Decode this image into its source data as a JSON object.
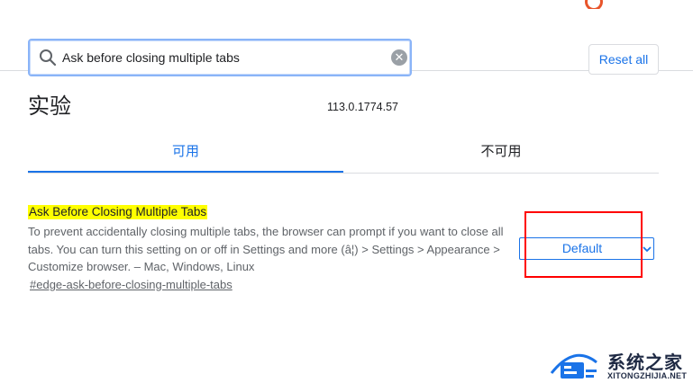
{
  "search": {
    "value": "Ask before closing multiple tabs",
    "clear_glyph": "✕",
    "icon": "search-icon"
  },
  "toolbar": {
    "reset_label": "Reset all"
  },
  "page": {
    "title": "实验",
    "version": "113.0.1774.57"
  },
  "tabs": [
    {
      "label": "可用",
      "active": true
    },
    {
      "label": "不可用",
      "active": false
    }
  ],
  "experiment": {
    "title": "Ask Before Closing Multiple Tabs",
    "description": "To prevent accidentally closing multiple tabs, the browser can prompt if you want to close all tabs. You can turn this setting on or off in Settings and more (â¦) > Settings > Appearance > Customize browser. – Mac, Windows, Linux",
    "link": "#edge-ask-before-closing-multiple-tabs",
    "select_value": "Default"
  },
  "watermark": {
    "title": "系统之家",
    "subtitle": "XITONGZHIJIA.NET"
  },
  "colors": {
    "accent": "#1a73e8",
    "highlight": "#ffff00",
    "annotation": "#ff0000"
  }
}
